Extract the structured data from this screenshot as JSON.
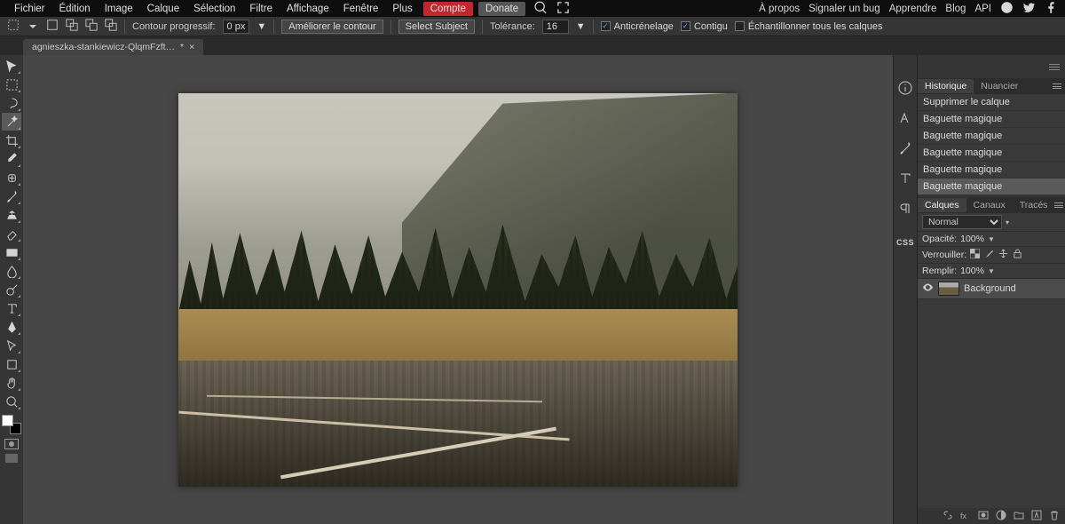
{
  "menu": {
    "items": [
      "Fichier",
      "Édition",
      "Image",
      "Calque",
      "Sélection",
      "Filtre",
      "Affichage",
      "Fenêtre",
      "Plus"
    ],
    "account": "Compte",
    "donate": "Donate",
    "right": [
      "À propos",
      "Signaler un bug",
      "Apprendre",
      "Blog",
      "API"
    ]
  },
  "options": {
    "feather_label": "Contour progressif:",
    "feather_value": "0 px",
    "refine": "Améliorer le contour",
    "select_subject": "Select Subject",
    "tolerance_label": "Tolérance:",
    "tolerance_value": "16",
    "antialias_label": "Anticrénelage",
    "antialias_checked": true,
    "contiguous_label": "Contigu",
    "contiguous_checked": true,
    "sample_all_label": "Échantillonner tous les calques",
    "sample_all_checked": false
  },
  "tab": {
    "filename": "agnieszka-stankiewicz-QlqmFzft…",
    "dirty": "*"
  },
  "history": {
    "tabs": [
      "Historique",
      "Nuancier"
    ],
    "active_tab": 0,
    "items": [
      "Supprimer le calque",
      "Baguette magique",
      "Baguette magique",
      "Baguette magique",
      "Baguette magique",
      "Baguette magique"
    ],
    "active_index": 5
  },
  "layers": {
    "tabs": [
      "Calques",
      "Canaux",
      "Tracés"
    ],
    "active_tab": 0,
    "blend_mode": "Normal",
    "opacity_label": "Opacité:",
    "opacity_value": "100%",
    "lock_label": "Verrouiller:",
    "fill_label": "Remplir:",
    "fill_value": "100%",
    "layer_name": "Background"
  },
  "right_strip": {
    "css_label": "CSS"
  }
}
